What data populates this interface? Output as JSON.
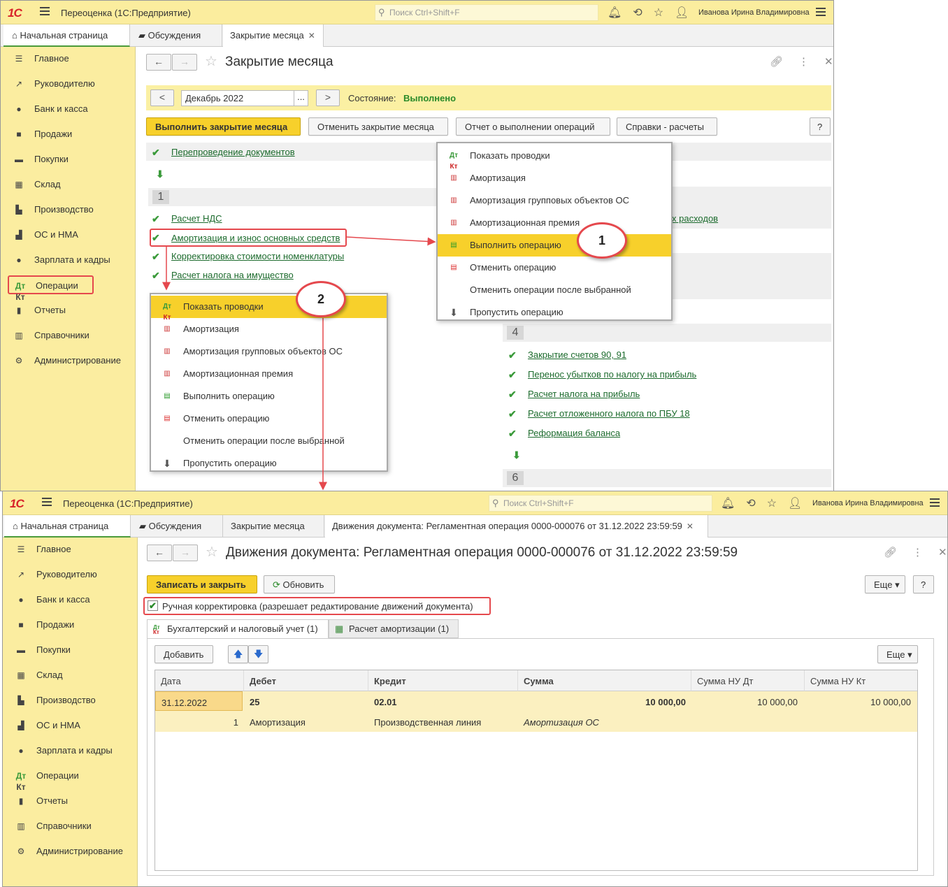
{
  "top": {
    "app_title": "Переоценка  (1С:Предприятие)",
    "search_placeholder": "Поиск Ctrl+Shift+F",
    "user_name": "Иванова Ирина Владимировна",
    "tabs": [
      "Начальная страница",
      "Обсуждения",
      "Закрытие месяца"
    ],
    "sidebar": [
      "Главное",
      "Руководителю",
      "Банк и касса",
      "Продажи",
      "Покупки",
      "Склад",
      "Производство",
      "ОС и НМА",
      "Зарплата и кадры",
      "Операции",
      "Отчеты",
      "Справочники",
      "Администрирование"
    ],
    "form_title": "Закрытие месяца",
    "period_value": "Декабрь 2022",
    "status_label": "Состояние:",
    "status_value": "Выполнено",
    "buttons": {
      "run_close": "Выполнить закрытие месяца",
      "cancel_close": "Отменить закрытие месяца",
      "report": "Отчет о выполнении операций",
      "calcs": "Справки - расчеты",
      "help": "?"
    },
    "repost_link": "Перепроведение документов",
    "stage1_num": "1",
    "stage1_links": [
      "Расчет НДС",
      "Амортизация и износ основных средств",
      "Корректировка стоимости номенклатуры",
      "Расчет налога на имущество"
    ],
    "right_partial_link": "х расходов",
    "stage4_num": "4",
    "stage4_links": [
      "Закрытие счетов 90, 91",
      "Перенос убытков по налогу на прибыль",
      "Расчет налога на прибыль",
      "Расчет отложенного налога по ПБУ 18",
      "Реформация баланса"
    ],
    "stage6_num": "6",
    "menu_items": [
      "Показать проводки",
      "Амортизация",
      "Амортизация групповых объектов ОС",
      "Амортизационная премия",
      "Выполнить операцию",
      "Отменить операцию",
      "Отменить операции после выбранной",
      "Пропустить операцию"
    ],
    "callout1": "1",
    "callout2": "2"
  },
  "bottom": {
    "tabs": [
      "Начальная страница",
      "Обсуждения",
      "Закрытие месяца",
      "Движения документа: Регламентная операция 0000-000076 от 31.12.2022 23:59:59"
    ],
    "form_title": "Движения документа: Регламентная операция 0000-000076 от 31.12.2022 23:59:59",
    "save_close": "Записать и закрыть",
    "refresh": "Обновить",
    "more": "Еще",
    "help": "?",
    "manual_label": "Ручная корректировка (разрешает редактирование движений документа)",
    "manual_checked": true,
    "subtabs": [
      "Бухгалтерский и налоговый учет (1)",
      "Расчет амортизации (1)"
    ],
    "add": "Добавить",
    "columns": [
      "Дата",
      "Дебет",
      "Кредит",
      "Сумма",
      "Сумма НУ Дт",
      "Сумма НУ Кт"
    ],
    "row": {
      "date": "31.12.2022",
      "debit": "25",
      "credit": "02.01",
      "sum": "10 000,00",
      "nu_dt": "10 000,00",
      "nu_kt": "10 000,00",
      "num": "1",
      "debit_sub": "Амортизация",
      "credit_sub": "Производственная линия",
      "content": "Амортизация ОС"
    }
  }
}
